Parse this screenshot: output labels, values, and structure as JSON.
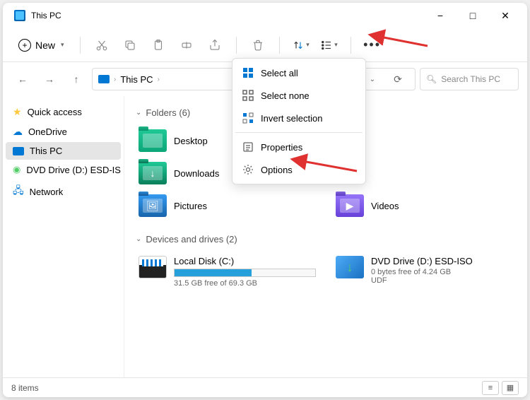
{
  "window": {
    "title": "This PC"
  },
  "toolbar": {
    "new_label": "New"
  },
  "address": {
    "location": "This PC",
    "search_placeholder": "Search This PC"
  },
  "sidebar": {
    "items": [
      {
        "label": "Quick access"
      },
      {
        "label": "OneDrive"
      },
      {
        "label": "This PC"
      },
      {
        "label": "DVD Drive (D:) ESD-ISO"
      },
      {
        "label": "Network"
      }
    ]
  },
  "sections": {
    "folders_header": "Folders (6)",
    "drives_header": "Devices and drives (2)"
  },
  "folders": [
    {
      "label": "Desktop"
    },
    {
      "label": "Downloads"
    },
    {
      "label": "Pictures"
    },
    {
      "label": "Videos"
    }
  ],
  "drives": [
    {
      "name": "Local Disk (C:)",
      "free_text": "31.5 GB free of 69.3 GB",
      "fill_pct": 55
    },
    {
      "name": "DVD Drive (D:) ESD-ISO",
      "free_text": "0 bytes free of 4.24 GB",
      "fs": "UDF"
    }
  ],
  "dropdown": {
    "select_all": "Select all",
    "select_none": "Select none",
    "invert": "Invert selection",
    "properties": "Properties",
    "options": "Options"
  },
  "status": {
    "count_text": "8 items"
  }
}
